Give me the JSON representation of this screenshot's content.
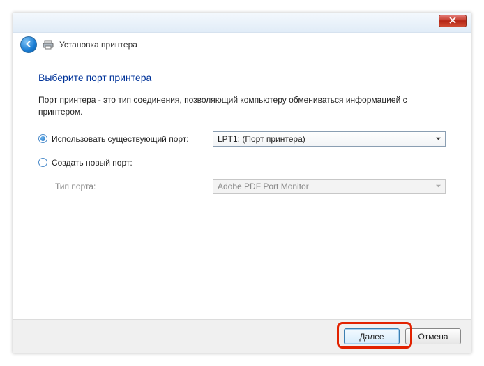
{
  "window": {
    "header_title": "Установка принтера"
  },
  "page": {
    "heading": "Выберите порт принтера",
    "description": "Порт принтера - это тип соединения, позволяющий компьютеру обмениваться информацией с принтером."
  },
  "options": {
    "use_existing_label": "Использовать существующий порт:",
    "use_existing_value": "LPT1: (Порт принтера)",
    "create_new_label": "Создать новый порт:",
    "port_type_label": "Тип порта:",
    "port_type_value": "Adobe PDF Port Monitor",
    "selected": "use_existing"
  },
  "buttons": {
    "next": "Далее",
    "cancel": "Отмена"
  }
}
